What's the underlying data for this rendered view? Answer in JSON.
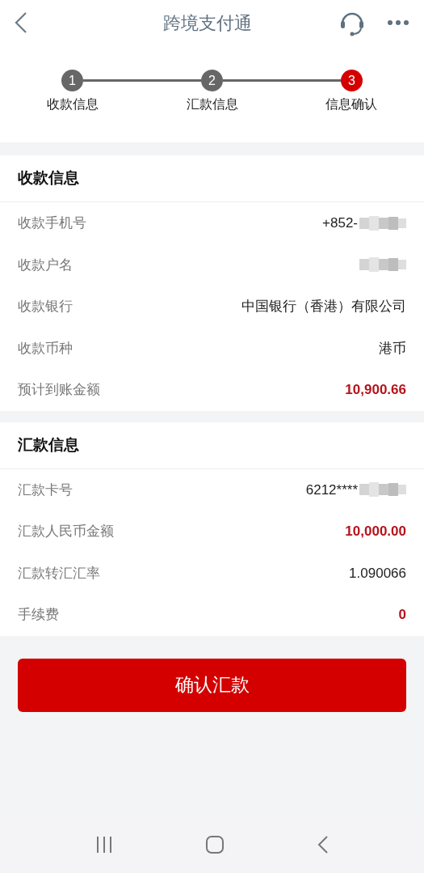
{
  "header": {
    "title": "跨境支付通"
  },
  "steps": [
    {
      "number": "1",
      "label": "收款信息",
      "selected": false
    },
    {
      "number": "2",
      "label": "汇款信息",
      "selected": false
    },
    {
      "number": "3",
      "label": "信息确认",
      "selected": true
    }
  ],
  "sections": [
    {
      "title": "收款信息",
      "rows": [
        {
          "label": "收款手机号",
          "value": "+852-",
          "redacted": true,
          "emphasis": false
        },
        {
          "label": "收款户名",
          "redacted": true
        },
        {
          "label": "收款银行",
          "value": "中国银行（香港）有限公司",
          "redacted": false,
          "emphasis": false
        },
        {
          "label": "收款币种",
          "value": "港币",
          "redacted": false,
          "emphasis": false
        },
        {
          "label": "预计到账金额",
          "value": "10,900.66",
          "redacted": false,
          "emphasis": true
        }
      ]
    },
    {
      "title": "汇款信息",
      "rows": [
        {
          "label": "汇款卡号",
          "value": "6212****",
          "redacted": true,
          "emphasis": false
        },
        {
          "label": "汇款人民币金额",
          "value": "10,000.00",
          "redacted": false,
          "emphasis": true
        },
        {
          "label": "汇款转汇汇率",
          "value": "1.090066",
          "redacted": false,
          "emphasis": false
        },
        {
          "label": "手续费",
          "value": "0",
          "redacted": false,
          "emphasis": true
        }
      ]
    }
  ],
  "confirm_button": "确认汇款"
}
